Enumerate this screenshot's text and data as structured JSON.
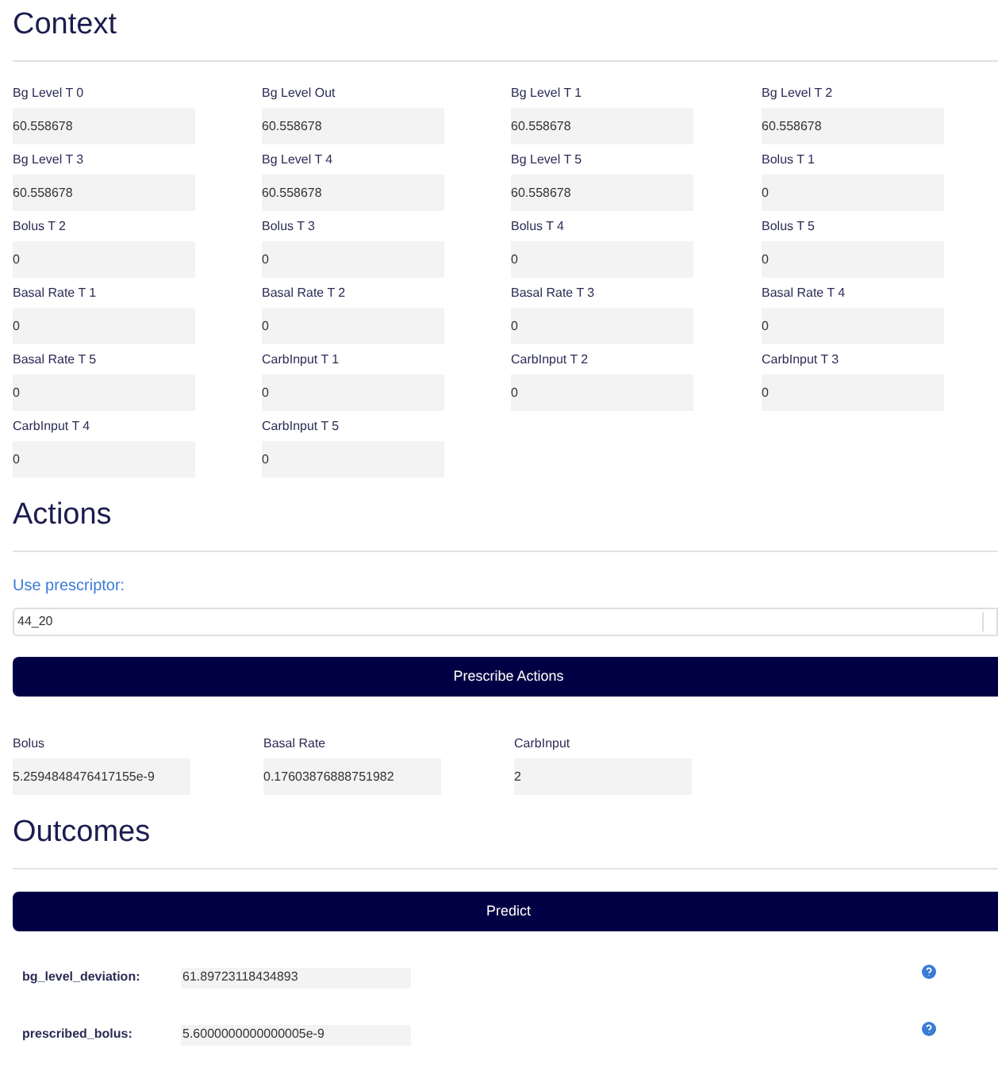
{
  "context": {
    "title": "Context",
    "fields": [
      {
        "label": "Bg Level T 0",
        "value": "60.558678"
      },
      {
        "label": "Bg Level Out",
        "value": "60.558678"
      },
      {
        "label": "Bg Level T 1",
        "value": "60.558678"
      },
      {
        "label": "Bg Level T 2",
        "value": "60.558678"
      },
      {
        "label": "Bg Level T 3",
        "value": "60.558678"
      },
      {
        "label": "Bg Level T 4",
        "value": "60.558678"
      },
      {
        "label": "Bg Level T 5",
        "value": "60.558678"
      },
      {
        "label": "Bolus T 1",
        "value": "0"
      },
      {
        "label": "Bolus T 2",
        "value": "0"
      },
      {
        "label": "Bolus T 3",
        "value": "0"
      },
      {
        "label": "Bolus T 4",
        "value": "0"
      },
      {
        "label": "Bolus T 5",
        "value": "0"
      },
      {
        "label": "Basal Rate T 1",
        "value": "0"
      },
      {
        "label": "Basal Rate T 2",
        "value": "0"
      },
      {
        "label": "Basal Rate T 3",
        "value": "0"
      },
      {
        "label": "Basal Rate T 4",
        "value": "0"
      },
      {
        "label": "Basal Rate T 5",
        "value": "0"
      },
      {
        "label": "CarbInput T 1",
        "value": "0"
      },
      {
        "label": "CarbInput T 2",
        "value": "0"
      },
      {
        "label": "CarbInput T 3",
        "value": "0"
      },
      {
        "label": "CarbInput T 4",
        "value": "0"
      },
      {
        "label": "CarbInput T 5",
        "value": "0"
      }
    ]
  },
  "actions": {
    "title": "Actions",
    "prescriptor_label": "Use prescriptor:",
    "prescriptor_value": "44_20",
    "button": "Prescribe Actions",
    "fields": [
      {
        "label": "Bolus",
        "value": "5.2594848476417155e-9"
      },
      {
        "label": "Basal Rate",
        "value": "0.17603876888751982"
      },
      {
        "label": "CarbInput",
        "value": "2"
      }
    ]
  },
  "outcomes": {
    "title": "Outcomes",
    "button": "Predict",
    "rows": [
      {
        "label": "bg_level_deviation:",
        "value": "61.89723118434893"
      },
      {
        "label": "prescribed_bolus:",
        "value": "5.6000000000000005e-9"
      }
    ]
  }
}
